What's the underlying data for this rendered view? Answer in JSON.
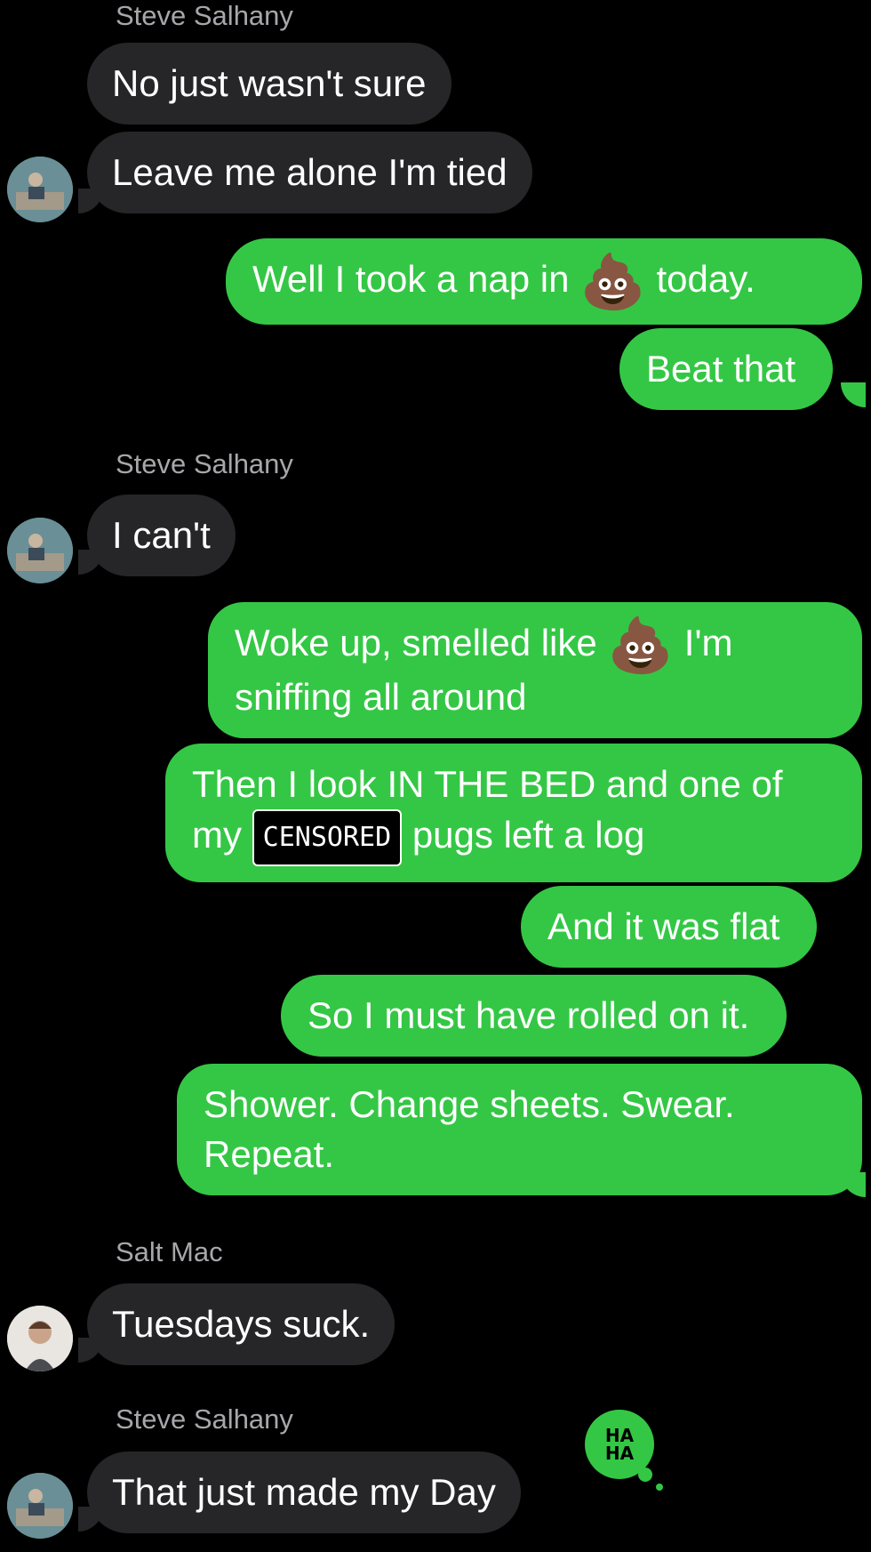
{
  "conversation": [
    {
      "type": "sender",
      "text": "Steve Salhany"
    },
    {
      "type": "incoming",
      "text": "No just wasn't sure"
    },
    {
      "type": "incoming",
      "text": "Leave me alone I'm tied"
    },
    {
      "type": "outgoing",
      "text_before": "Well I took a nap in ",
      "emoji": "💩",
      "text_after": " today."
    },
    {
      "type": "outgoing",
      "text": "Beat that"
    },
    {
      "type": "sender",
      "text": "Steve Salhany"
    },
    {
      "type": "incoming",
      "text": "I can't"
    },
    {
      "type": "outgoing",
      "text_before": "Woke up, smelled like ",
      "emoji": "💩",
      "text_after": " I'm sniffing all around"
    },
    {
      "type": "outgoing",
      "text_before": "Then I look IN THE BED and one of my ",
      "censor": "CENSORED",
      "text_after": " pugs left a log"
    },
    {
      "type": "outgoing",
      "text": "And it was flat"
    },
    {
      "type": "outgoing",
      "text": "So I must have rolled on it."
    },
    {
      "type": "outgoing",
      "text": "Shower. Change sheets. Swear. Repeat."
    },
    {
      "type": "sender",
      "text": "Salt Mac"
    },
    {
      "type": "incoming",
      "text": "Tuesdays suck."
    },
    {
      "type": "sender",
      "text": "Steve Salhany"
    },
    {
      "type": "incoming",
      "text": "That  just made my Day"
    }
  ],
  "reaction": {
    "text": "HA HA",
    "color": "#34c745"
  },
  "colors": {
    "incoming": "#262628",
    "outgoing": "#34c745",
    "background": "#000000"
  }
}
